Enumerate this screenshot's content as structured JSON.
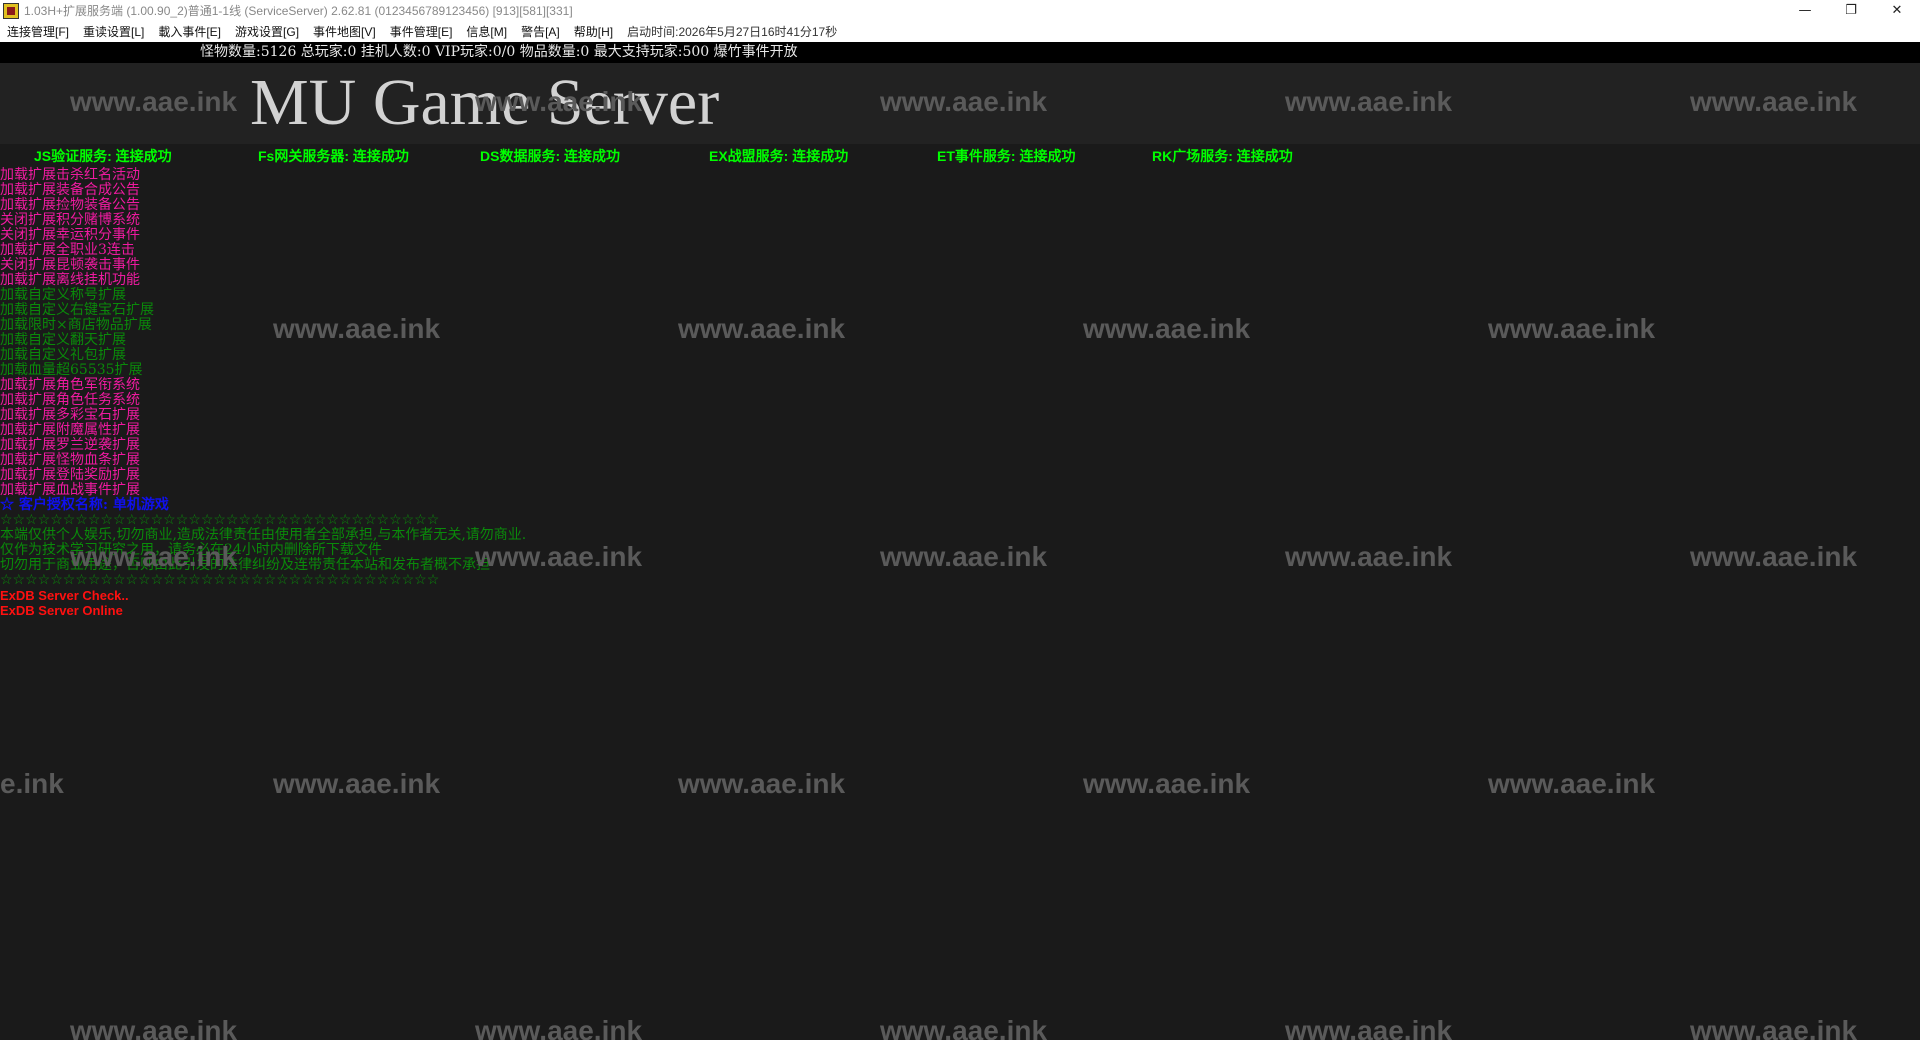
{
  "window": {
    "title": "1.03H+扩展服务端 (1.00.90_2)普通1-1线 (ServiceServer) 2.62.81 (0123456789123456) [913][581][331]",
    "minimize_label": "—",
    "maximize_label": "❐",
    "close_label": "✕",
    "icon": "mu-app-icon"
  },
  "menu": {
    "items": [
      "连接管理[F]",
      "重读设置[L]",
      "載入事件[E]",
      "游戏设置[G]",
      "事件地图[V]",
      "事件管理[E]",
      "信息[M]",
      "警告[A]",
      "帮助[H]"
    ],
    "startup_time": "启动时间:2026年5月27日16时41分17秒"
  },
  "stats": {
    "text": "怪物数量:5126 总玩家:0 挂机人数:0 VIP玩家:0/0 物品数量:0 最大支持玩家:500 爆竹事件开放"
  },
  "banner": {
    "title": "MU Game Server"
  },
  "services": [
    "JS验证服务: 连接成功",
    "Fs网关服务器: 连接成功",
    "DS数据服务: 连接成功",
    "EX战盟服务: 连接成功",
    "ET事件服务: 连接成功",
    "RK广场服务: 连接成功"
  ],
  "log_lines": [
    {
      "text": "加载扩展击杀红名活动",
      "color": "magenta"
    },
    {
      "text": "加载扩展装备合成公告",
      "color": "magenta"
    },
    {
      "text": "加载扩展捡物装备公告",
      "color": "magenta"
    },
    {
      "text": "关闭扩展积分赌博系统",
      "color": "magenta"
    },
    {
      "text": "关闭扩展幸运积分事件",
      "color": "magenta"
    },
    {
      "text": "加载扩展全职业3连击",
      "color": "magenta"
    },
    {
      "text": "关闭扩展昆顿袭击事件",
      "color": "magenta"
    },
    {
      "text": "加载扩展离线挂机功能",
      "color": "magenta"
    },
    {
      "text": "加载自定义称号扩展",
      "color": "green"
    },
    {
      "text": "加载自定义右键宝石扩展",
      "color": "green"
    },
    {
      "text": "加载限时×商店物品扩展",
      "color": "green"
    },
    {
      "text": "加载自定义翻天扩展",
      "color": "green"
    },
    {
      "text": "加载自定义礼包扩展",
      "color": "green"
    },
    {
      "text": "加载血量超65535扩展",
      "color": "green"
    },
    {
      "text": "加载扩展角色军衔系统",
      "color": "magenta"
    },
    {
      "text": "加载扩展角色任务系统",
      "color": "magenta"
    },
    {
      "text": "加载扩展多彩宝石扩展",
      "color": "magenta"
    },
    {
      "text": "加载扩展附魔属性扩展",
      "color": "magenta"
    },
    {
      "text": "加载扩展罗兰逆袭扩展",
      "color": "magenta"
    },
    {
      "text": "加载扩展怪物血条扩展",
      "color": "magenta"
    },
    {
      "text": "加载扩展登陆奖励扩展",
      "color": "magenta"
    },
    {
      "text": "加载扩展血战事件扩展",
      "color": "magenta"
    },
    {
      "text": "☆ 客户授权名称: 单机游戏",
      "color": "blue"
    },
    {
      "text": "☆☆☆☆☆☆☆☆☆☆☆☆☆☆☆☆☆☆☆☆☆☆☆☆☆☆☆☆☆☆☆☆☆☆☆",
      "color": "green"
    },
    {
      "text": "本端仅供个人娱乐,切勿商业,造成法律责任由使用者全部承担,与本作者无关,请勿商业.",
      "color": "green"
    },
    {
      "text": "仅作为技术学习研究之用，请务必在24小时内删除所下载文件",
      "color": "green"
    },
    {
      "text": "切勿用于商业用途，否则由此引发的法律纠纷及连带责任本站和发布者概不承担",
      "color": "green"
    },
    {
      "text": "☆☆☆☆☆☆☆☆☆☆☆☆☆☆☆☆☆☆☆☆☆☆☆☆☆☆☆☆☆☆☆☆☆☆☆",
      "color": "green"
    },
    {
      "text": "ExDB Server Check..",
      "color": "red"
    },
    {
      "text": "ExDB Server Online",
      "color": "red"
    }
  ],
  "colors": {
    "magenta": "#ee1aa0",
    "green": "#0a8a0a",
    "blue": "#1010ee",
    "red": "#ff1010",
    "service_ok": "#00ff00"
  },
  "watermark": {
    "text": "www.aae.ink",
    "partial": "e.ink"
  }
}
